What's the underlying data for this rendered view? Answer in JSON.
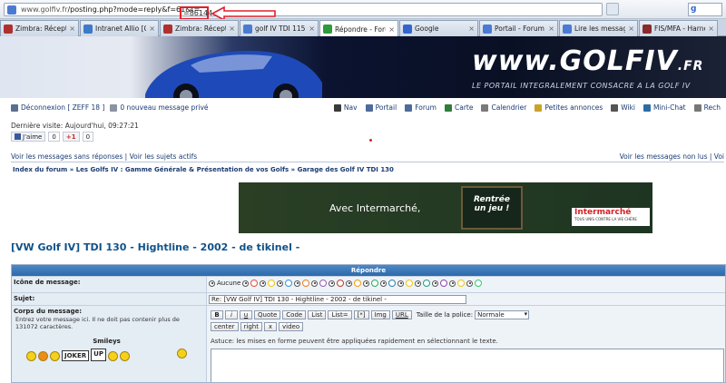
{
  "browser": {
    "url_domain": "www.golfiv.fr",
    "url_path": "/posting.php?mode=reply&f=61&t=",
    "url_highlight": "=86144",
    "search_engine": "Google"
  },
  "tabs": [
    {
      "label": "Zimbra: Réceptio...",
      "color": "#b03030",
      "active": false
    },
    {
      "label": "Intranet Allio [Ge...",
      "color": "#3d7ac8",
      "active": false
    },
    {
      "label": "Zimbra: Réceptio...",
      "color": "#b03030",
      "active": false
    },
    {
      "label": "golf IV TDI 115 d'...",
      "color": "#4a7bd1",
      "active": false
    },
    {
      "label": "Répondre - Foru...",
      "color": "#2f9a3a",
      "active": true
    },
    {
      "label": "Google",
      "color": "#3366cc",
      "active": false
    },
    {
      "label": "Portail - Forum V...",
      "color": "#4a7bd1",
      "active": false
    },
    {
      "label": "Lire les messages...",
      "color": "#4a7bd1",
      "active": false
    },
    {
      "label": "FIS/MFA - Harne...",
      "color": "#8a2a2a",
      "active": false
    }
  ],
  "banner": {
    "logo": "www.GOLFIV",
    "logo_suffix": ".FR",
    "tagline": "LE PORTAIL INTEGRALEMENT CONSACRE A LA GOLF IV"
  },
  "topnav": {
    "logout": "Déconnexion [ ZEFF 18 ]",
    "pm": "0 nouveau message privé",
    "items": [
      "Nav",
      "Portail",
      "Forum",
      "Carte",
      "Calendrier",
      "Petites annonces",
      "Wiki",
      "Mini-Chat",
      "Rech"
    ]
  },
  "last_visit": "Dernière visite: Aujourd'hui, 09:27:21",
  "social": {
    "like": "J'aime",
    "like_count": "0",
    "gplus": "+1",
    "gplus_count": "0"
  },
  "links": {
    "left": "Voir les messages sans réponses | Voir les sujets actifs",
    "right": "Voir les messages non lus | Voi"
  },
  "breadcrumb": "Index du forum » Les Golfs IV : Gamme Générale & Présentation de vos Golfs » Garage des Golf IV TDI 130",
  "ad": {
    "text": "Avec Intermarché,",
    "board_line1": "Rentrée",
    "board_line2": "un jeu !",
    "brand": "Intermarché",
    "brand_small": "TOUS UNIS CONTRE LA VIE CHÈRE"
  },
  "topic_title": "[VW Golf IV] TDI 130 - Hightline - 2002 - de tikinel -",
  "form": {
    "header": "Répondre",
    "icon_label": "Icône de message:",
    "icon_none": "Aucune",
    "subject_label": "Sujet:",
    "subject_value": "Re: [VW Golf IV] TDI 130 - Hightline - 2002 - de tikinel -",
    "body_label": "Corps du message:",
    "body_desc": "Entrez votre message ici. Il ne doit pas contenir plus de 131072 caractères.",
    "smileys_label": "Smileys",
    "sign_joker": "JOKER",
    "sign_up": "UP",
    "buttons": [
      "B",
      "i",
      "u",
      "Quote",
      "Code",
      "List",
      "List=",
      "[*]",
      "Img",
      "URL"
    ],
    "buttons2": [
      "center",
      "right",
      "x",
      "video"
    ],
    "font_size_label": "Taille de la police:",
    "font_size_value": "Normale",
    "hint": "Astuce: les mises en forme peuvent être appliquées rapidement en sélectionnant le texte."
  }
}
